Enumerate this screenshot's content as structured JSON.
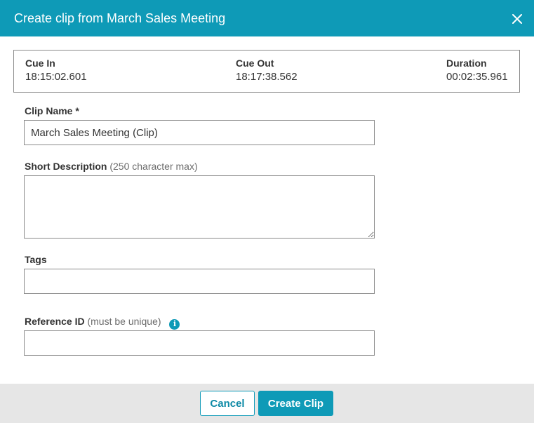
{
  "dialog": {
    "title": "Create clip from March Sales Meeting",
    "close_icon": "close-icon"
  },
  "cue": {
    "in_label": "Cue In",
    "in_value": "18:15:02.601",
    "out_label": "Cue Out",
    "out_value": "18:17:38.562",
    "duration_label": "Duration",
    "duration_value": "00:02:35.961"
  },
  "form": {
    "clip_name": {
      "label": "Clip Name *",
      "value": "March Sales Meeting (Clip)"
    },
    "short_description": {
      "label": "Short Description",
      "hint": "(250 character max)",
      "value": ""
    },
    "tags": {
      "label": "Tags",
      "value": ""
    },
    "reference_id": {
      "label": "Reference ID",
      "hint": "(must be unique)",
      "info_icon": "info-icon",
      "value": ""
    }
  },
  "footer": {
    "cancel_label": "Cancel",
    "create_label": "Create Clip"
  },
  "colors": {
    "accent": "#0e9ab7",
    "footer_bg": "#e6e6e6",
    "border": "#8a8a8a"
  }
}
